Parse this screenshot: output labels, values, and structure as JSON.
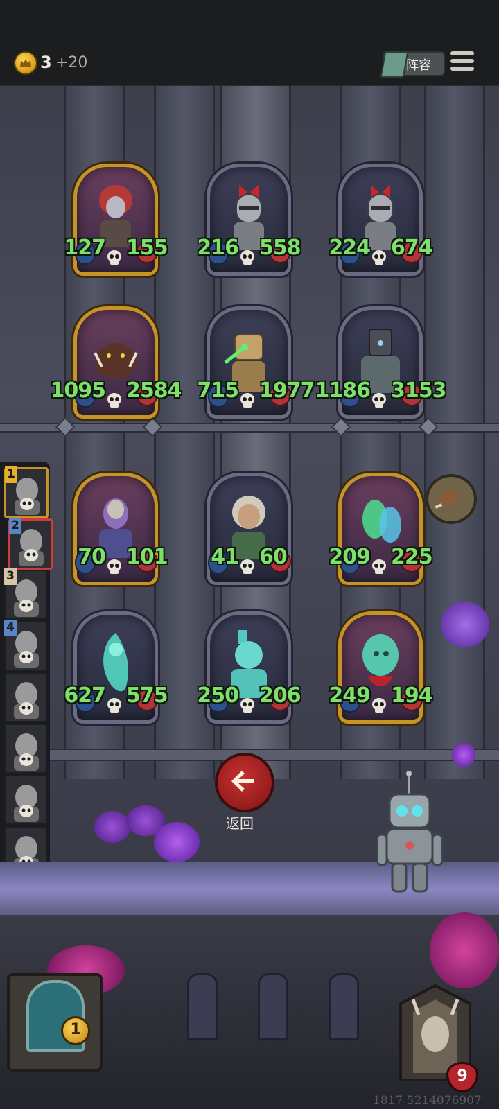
{
  "top_bar": {
    "coin_icon": "crown-coin-icon",
    "coin_count": "3",
    "coin_income": "+20",
    "lineup_label": "阵容",
    "menu_icon": "hamburger-icon"
  },
  "cards": [
    {
      "attack": "127",
      "health": "155",
      "frame": "gold",
      "art": "red-haired-warrior-woman"
    },
    {
      "attack": "216",
      "health": "558",
      "frame": "silver",
      "art": "knight-with-red-bow"
    },
    {
      "attack": "224",
      "health": "674",
      "frame": "silver",
      "art": "knight-with-red-bow"
    },
    {
      "attack": "1095",
      "health": "2584",
      "frame": "gold",
      "art": "boar-beast"
    },
    {
      "attack": "715",
      "health": "1977",
      "frame": "silver",
      "art": "bronze-golem"
    },
    {
      "attack": "1186",
      "health": "3153",
      "frame": "silver",
      "art": "iron-giant"
    },
    {
      "attack": "70",
      "health": "101",
      "frame": "gold",
      "art": "masked-sorceress"
    },
    {
      "attack": "41",
      "health": "60",
      "frame": "silver",
      "art": "old-woman"
    },
    {
      "attack": "209",
      "health": "225",
      "frame": "gold",
      "art": "green-ghosts"
    },
    {
      "attack": "627",
      "health": "575",
      "frame": "silver",
      "art": "ghost-mermaid"
    },
    {
      "attack": "250",
      "health": "206",
      "frame": "silver",
      "art": "ghost-soldier"
    },
    {
      "attack": "249",
      "health": "194",
      "frame": "gold",
      "art": "ghost-specter"
    }
  ],
  "queue": [
    {
      "num": "1",
      "art": "goat-demon"
    },
    {
      "num": "2",
      "art": "hooded-figure"
    },
    {
      "num": "3",
      "art": "bearded-wizard"
    },
    {
      "num": "4",
      "art": "masked-rogue"
    },
    {
      "num": "",
      "art": "bat-creature"
    },
    {
      "num": "",
      "art": "crow-bird"
    },
    {
      "num": "",
      "art": "top-hat-gentleman"
    },
    {
      "num": "",
      "art": "wolf-beast"
    }
  ],
  "back_button": {
    "label": "返回",
    "icon": "left-arrow-icon"
  },
  "bottom": {
    "player_gold": "1",
    "opponent_hp": "9",
    "footer_id": "1817 5214076907"
  },
  "colors": {
    "stat_green": "#7ee06a",
    "gold_frame": "#c59429",
    "silver_frame": "#6b6a82",
    "back_red": "#c8302f"
  }
}
